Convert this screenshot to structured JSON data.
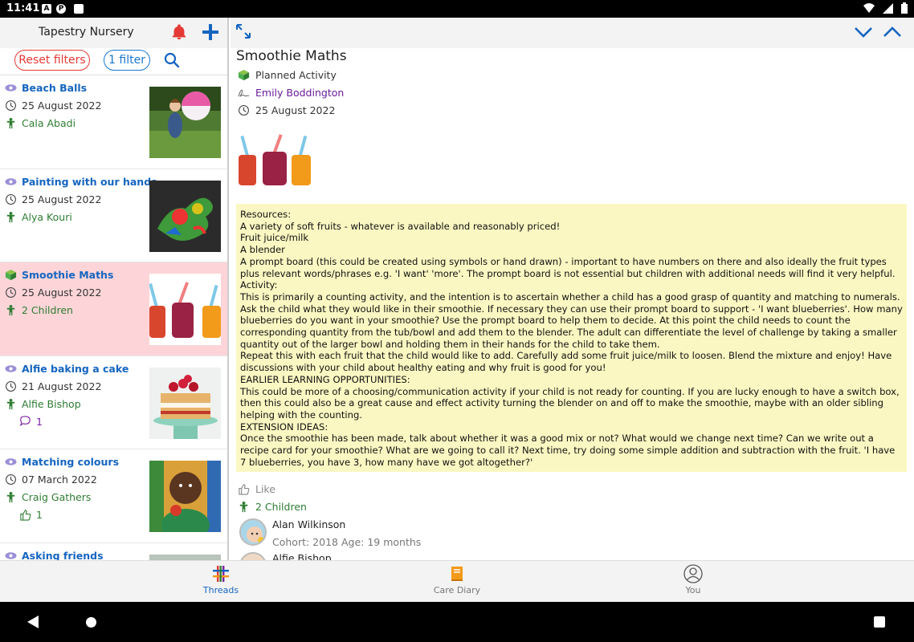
{
  "status_bar": {
    "time": "11:41"
  },
  "left_header": {
    "title": "Tapestry Nursery"
  },
  "filters": {
    "reset_label": "Reset filters",
    "filter_label": "1 filter"
  },
  "list_items": [
    {
      "title": "Beach Balls",
      "date": "25 August 2022",
      "children": "Cala Abadi",
      "extra": ""
    },
    {
      "title": "Painting with our hands",
      "date": "25 August 2022",
      "children": "Alya Kouri",
      "extra": ""
    },
    {
      "title": "Smoothie Maths",
      "date": "25 August 2022",
      "children": "2 Children",
      "extra": ""
    },
    {
      "title": "Alfie baking a cake",
      "date": "21 August 2022",
      "children": "Alfie Bishop",
      "extra": "1"
    },
    {
      "title": "Matching colours",
      "date": "07 March 2022",
      "children": "Craig Gathers",
      "extra": "1"
    },
    {
      "title": "Asking friends",
      "date": "",
      "children": "",
      "extra": ""
    }
  ],
  "detail": {
    "title": "Smoothie Maths",
    "type": "Planned Activity",
    "author": "Emily Boddington",
    "date": "25 August 2022",
    "body": "Resources:\nA variety of soft fruits - whatever is available and reasonably priced!\nFruit juice/milk\nA blender\nA prompt board (this could be created using symbols or hand drawn) - important to have numbers on there and also ideally the fruit types plus relevant words/phrases e.g. 'I want' 'more'. The prompt board is not essential but children with additional needs will find it very helpful.\nActivity:\nThis is primarily a counting activity, and the intention is to ascertain whether a child has a good grasp of quantity and matching to numerals. Ask the child what they would like in their smoothie. If necessary they can use their prompt board to support - 'I want blueberries'. How many blueberries do you want in your smoothie? Use the prompt board to help them to decide. At this point the child needs to count the corresponding quantity from the tub/bowl and add them to the blender. The adult can differentiate the level of challenge by taking a smaller quantity out of the larger bowl and holding them in their hands for the child to take them.\nRepeat this with each fruit that the child would like to add. Carefully add some fruit juice/milk to loosen. Blend the mixture and enjoy! Have discussions with your child about healthy eating and why fruit is good for you!\nEARLIER LEARNING OPPORTUNITIES:\nThis could be more of a choosing/communication activity if your child is not ready for counting. If you are lucky enough to have a switch box, then this could also be a great cause and effect activity turning the blender on and off to make the smoothie, maybe with an older sibling helping with the counting.\nEXTENSION IDEAS:\nOnce the smoothie has been made, talk about whether it was a good mix or not? What would we change next time? Can we write out a recipe card for your smoothie? What are we going to call it? Next time, try doing some simple addition and subtraction with the fruit. 'I have 7 blueberries, you have 3, how many have we got altogether?'",
    "like_label": "Like",
    "children_label": "2 Children",
    "children": [
      {
        "name": "Alan Wilkinson",
        "info": "Cohort: 2018 Age: 19 months"
      },
      {
        "name": "Alfie Bishop",
        "info": ""
      }
    ]
  },
  "bottom_nav": {
    "threads": "Threads",
    "care_diary": "Care Diary",
    "you": "You"
  },
  "colors": {
    "accent_blue": "#1565c0",
    "alert_red": "#e53935",
    "selected_bg": "#fdd5d8",
    "content_bg": "#fbf7c2",
    "child_green": "#2e7d32"
  }
}
